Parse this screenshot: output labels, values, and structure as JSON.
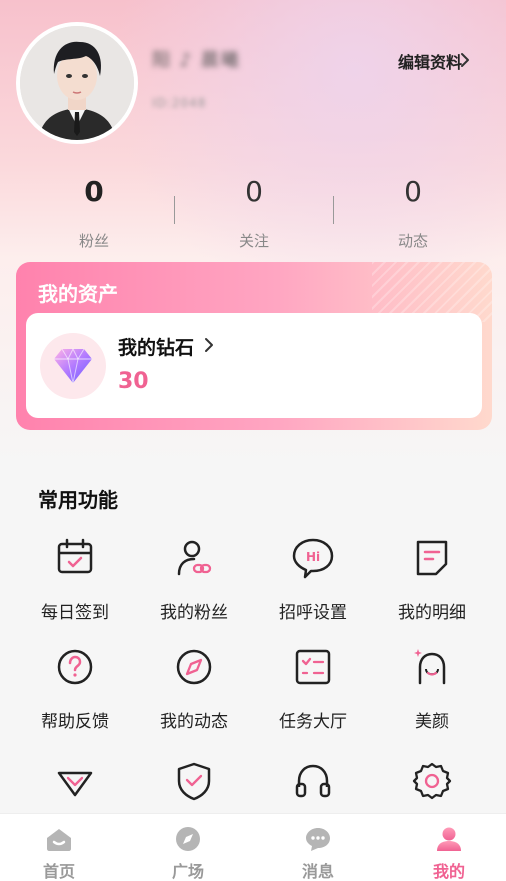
{
  "profile": {
    "nickname": "阳 ♪ 晨曦",
    "user_id": "ID:2048",
    "edit_label": "编辑资料"
  },
  "stats": [
    {
      "value": "0",
      "label": "粉丝"
    },
    {
      "value": "0",
      "label": "关注"
    },
    {
      "value": "0",
      "label": "动态"
    }
  ],
  "assets": {
    "title": "我的资产",
    "diamond_label": "我的钻石",
    "diamond_count": "30"
  },
  "functions": {
    "title": "常用功能",
    "items": [
      {
        "label": "每日签到",
        "icon": "calendar-check-icon"
      },
      {
        "label": "我的粉丝",
        "icon": "user-link-icon"
      },
      {
        "label": "招呼设置",
        "icon": "hi-bubble-icon"
      },
      {
        "label": "我的明细",
        "icon": "document-icon"
      },
      {
        "label": "帮助反馈",
        "icon": "help-icon"
      },
      {
        "label": "我的动态",
        "icon": "compass-icon"
      },
      {
        "label": "任务大厅",
        "icon": "checklist-icon"
      },
      {
        "label": "美颜",
        "icon": "face-beauty-icon"
      },
      {
        "label": "",
        "icon": "diamond-outline-icon"
      },
      {
        "label": "",
        "icon": "shield-check-icon"
      },
      {
        "label": "",
        "icon": "headset-icon"
      },
      {
        "label": "",
        "icon": "gear-icon"
      }
    ]
  },
  "tabs": [
    {
      "label": "首页",
      "icon": "home-icon"
    },
    {
      "label": "广场",
      "icon": "compass-icon"
    },
    {
      "label": "消息",
      "icon": "chat-icon"
    },
    {
      "label": "我的",
      "icon": "profile-icon"
    }
  ],
  "colors": {
    "accent": "#f06292",
    "assets_gradient_start": "#ff82ad",
    "assets_gradient_end": "#ffd9cd"
  }
}
